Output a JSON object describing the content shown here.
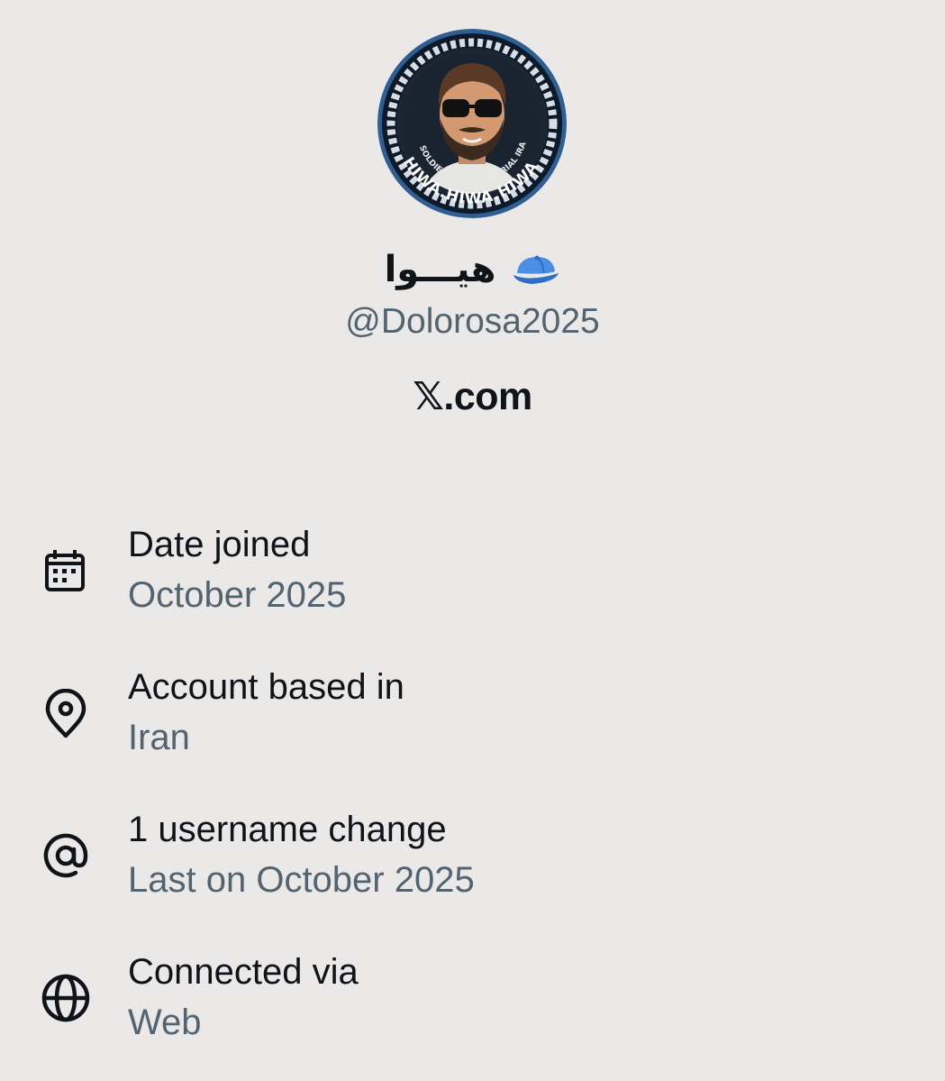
{
  "profile": {
    "display_name": "هیـــوا",
    "cap_emoji": "blue-cap-icon",
    "handle": "@Dolorosa2025",
    "source": "𝕏.com",
    "avatar_ring_text_top": "SOLDIER OF THE IMPERIAL IRANIAN ARMY",
    "avatar_ring_text_bottom": "HIWA.HIWA.HIWA"
  },
  "details": [
    {
      "icon": "calendar-icon",
      "label": "Date joined",
      "value": "October 2025"
    },
    {
      "icon": "location-pin-icon",
      "label": "Account based in",
      "value": "Iran"
    },
    {
      "icon": "at-sign-icon",
      "label": "1 username change",
      "value": "Last on October 2025"
    },
    {
      "icon": "globe-icon",
      "label": "Connected via",
      "value": "Web"
    }
  ],
  "colors": {
    "background": "#ebe9e8",
    "primary_text": "#0f1419",
    "secondary_text": "#536471",
    "cap_blue": "#4a8ee6"
  }
}
